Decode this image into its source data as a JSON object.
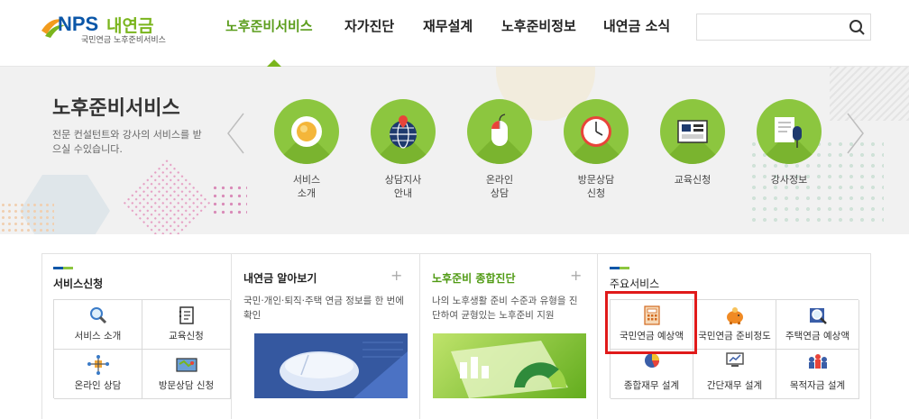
{
  "header": {
    "logo_nps": "NPS",
    "logo_kr": "내연금",
    "logo_sub": "국민연금 노후준비서비스",
    "nav": [
      "노후준비서비스",
      "자가진단",
      "재무설계",
      "노후준비정보",
      "내연금 소식"
    ],
    "active_nav": "노후준비서비스",
    "search_placeholder": "",
    "search_icon": "search-icon"
  },
  "banner": {
    "title": "노후준비서비스",
    "desc": "전문 컨설턴트와 강사의 서비스를 받으실 수있습니다.",
    "services": [
      {
        "label": "서비스\n소개",
        "icon": "coffee-cup-icon"
      },
      {
        "label": "상담지사\n안내",
        "icon": "globe-pin-icon"
      },
      {
        "label": "온라인\n상담",
        "icon": "mouse-icon"
      },
      {
        "label": "방문상담\n신청",
        "icon": "clock-icon"
      },
      {
        "label": "교육신청",
        "icon": "calendar-board-icon"
      },
      {
        "label": "강사정보",
        "icon": "microphone-document-icon"
      }
    ]
  },
  "panels": {
    "service_apply": {
      "title": "서비스신청",
      "items": [
        {
          "label": "서비스 소개",
          "icon": "magnifier-icon"
        },
        {
          "label": "교육신청",
          "icon": "notebook-icon"
        },
        {
          "label": "온라인 상담",
          "icon": "network-icon"
        },
        {
          "label": "방문상담 신청",
          "icon": "map-icon"
        }
      ]
    },
    "know_pension": {
      "title": "내연금 알아보기",
      "plus": "+",
      "desc": "국민·개인·퇴직·주택 연금 정보를 한 번에 확인"
    },
    "diagnosis": {
      "title": "노후준비 종합진단",
      "plus": "+",
      "desc": "나의 노후생활 준비 수준과 유형을 진단하여 균형있는 노후준비 지원"
    },
    "main_services": {
      "title": "주요서비스",
      "items": [
        {
          "label": "국민연금 예상액",
          "icon": "calculator-icon"
        },
        {
          "label": "국민연금 준비정도",
          "icon": "piggy-bank-icon"
        },
        {
          "label": "주택연금 예상액",
          "icon": "house-search-icon"
        },
        {
          "label": "종합재무 설계",
          "icon": "pie-chart-icon"
        },
        {
          "label": "간단재무 설계",
          "icon": "monitor-chart-icon"
        },
        {
          "label": "목적자금 설계",
          "icon": "people-goal-icon"
        }
      ]
    }
  },
  "colors": {
    "brand_blue": "#0a56a8",
    "brand_green": "#8cc63f",
    "active_green": "#5b9d1c",
    "highlight_red": "#e01a1a"
  }
}
